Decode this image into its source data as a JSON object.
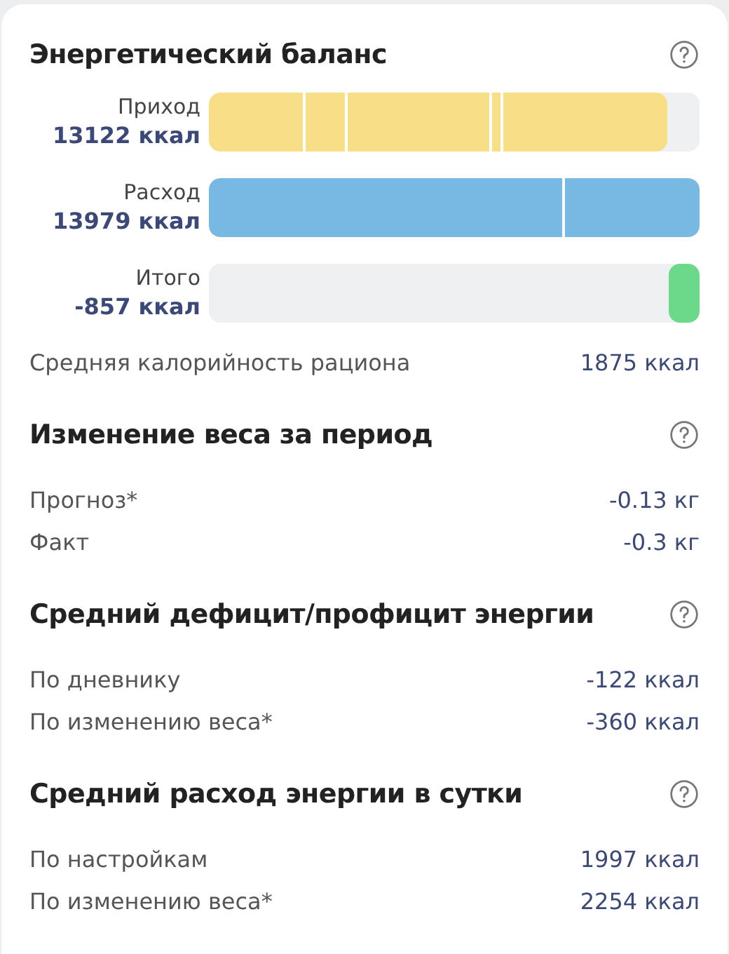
{
  "balance": {
    "title": "Энергетический баланс",
    "bars": [
      {
        "label": "Приход",
        "value": "13122 ккал",
        "color": "#f8df87",
        "level": 0.934
      },
      {
        "label": "Расход",
        "value": "13979 ккал",
        "color": "#78b9e4",
        "level": 1.0
      },
      {
        "label": "Итого",
        "value": "-857 ккал",
        "color": "#6cd98a",
        "align_end": true,
        "level": 0.063
      }
    ],
    "rows": [
      {
        "label": "Средняя калорийность рациона",
        "value": "1875 ккал"
      }
    ]
  },
  "sections": [
    {
      "title": "Изменение веса за период",
      "rows": [
        {
          "label": "Прогноз*",
          "value": "-0.13 кг"
        },
        {
          "label": "Факт",
          "value": "-0.3 кг"
        }
      ]
    },
    {
      "title": "Средний дефицит/профицит энергии",
      "rows": [
        {
          "label": "По дневнику",
          "value": "-122 ккал"
        },
        {
          "label": "По изменению веса*",
          "value": "-360 ккал"
        }
      ]
    },
    {
      "title": "Средний расход энергии в сутки",
      "rows": [
        {
          "label": "По настройкам",
          "value": "1997 ккал"
        },
        {
          "label": "По изменению веса*",
          "value": "2254 ккал"
        }
      ]
    }
  ]
}
